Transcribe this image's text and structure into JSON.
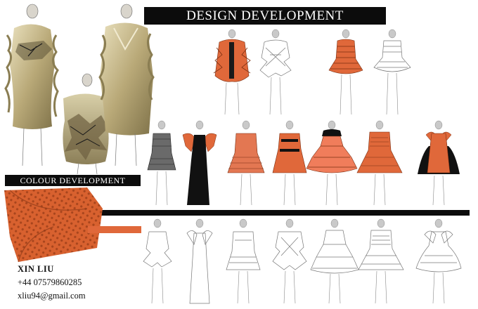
{
  "headings": {
    "design": "DESIGN DEVELOPMENT",
    "colour": "COLOUR DEVELOPMENT"
  },
  "contact": {
    "name": "XIN LIU",
    "phone": "+44 07579860285",
    "email": "xliu94@gmail.com"
  },
  "colors": {
    "accent": "#e0683a",
    "accent_dark": "#c7502a",
    "black": "#0c0c0c",
    "photo_khaki": "#a8996a"
  }
}
